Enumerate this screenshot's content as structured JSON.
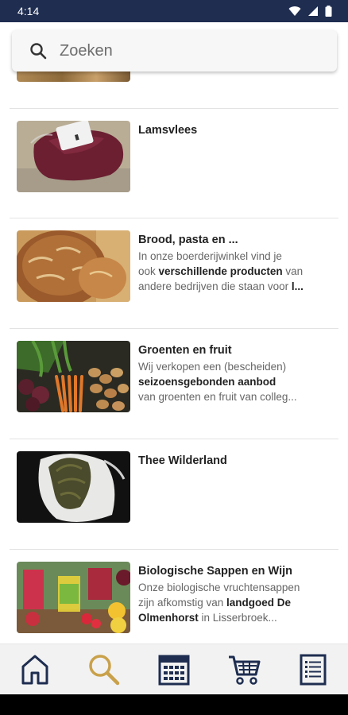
{
  "status_bar": {
    "time": "4:14"
  },
  "search": {
    "placeholder": "Zoeken"
  },
  "items": [
    {
      "title": "Lamsvlees"
    },
    {
      "title": "Brood, pasta en ...",
      "desc_line1": "In onze boerderijwinkel vind je",
      "desc_line2_pre": "ook ",
      "desc_line2_bold": "verschillende producten",
      "desc_line2_post": " van",
      "desc_line3_pre": "andere bedrijven die staan voor ",
      "desc_line3_bold": "l..."
    },
    {
      "title": "Groenten en fruit",
      "desc_line1": "Wij verkopen een (bescheiden)",
      "desc_line2_bold": "seizoensgebonden aanbod",
      "desc_line3": "van groenten en fruit van colleg..."
    },
    {
      "title": "Thee Wilderland"
    },
    {
      "title": "Biologische Sappen en Wijn",
      "desc_line1": "Onze biologische vruchtensappen",
      "desc_line2_pre": "zijn afkomstig van ",
      "desc_line2_bold": "landgoed De",
      "desc_line3_bold": "Olmenhorst",
      "desc_line3_post": " in Lisserbroek..."
    }
  ],
  "nav": {
    "items": [
      {
        "icon": "home-icon"
      },
      {
        "icon": "search-icon",
        "active": true
      },
      {
        "icon": "calendar-icon"
      },
      {
        "icon": "cart-icon"
      },
      {
        "icon": "list-icon"
      }
    ],
    "colors": {
      "default": "#1e2d50",
      "active": "#c9a14a"
    }
  }
}
